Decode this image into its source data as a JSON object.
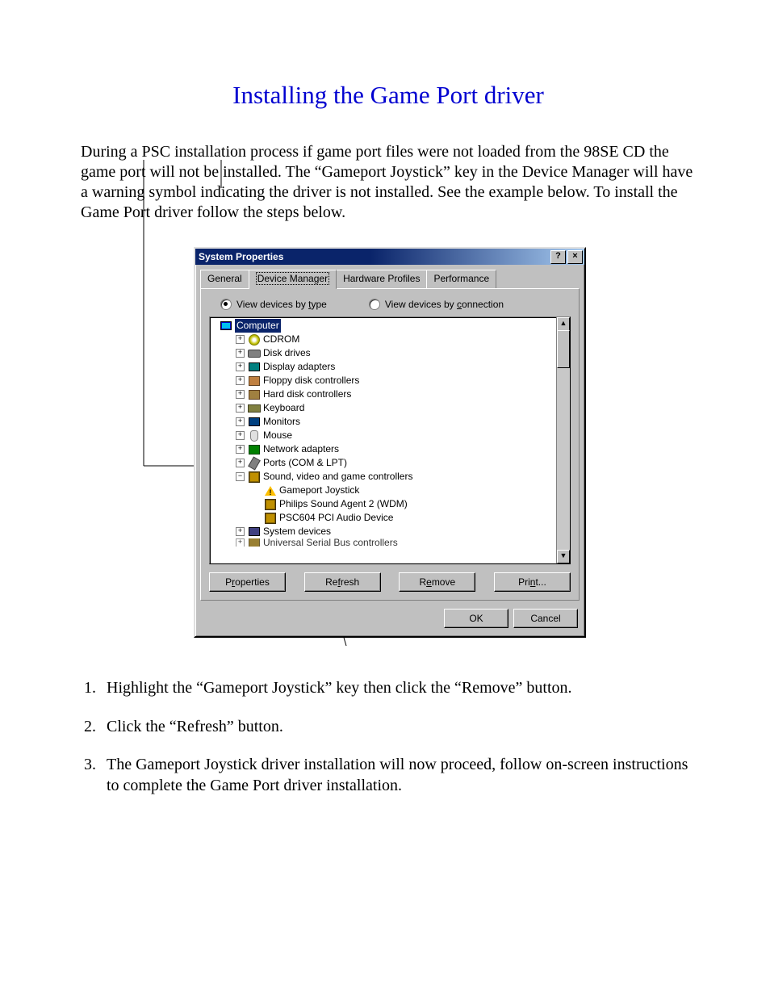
{
  "page": {
    "title": "Installing the Game Port driver",
    "intro": "During a PSC installation process if game port files were not loaded from the 98SE CD the game port will not be installed. The “Gameport Joystick” key in the Device Manager will have a warning symbol indicating the driver is not installed. See the example below. To install the Game Port driver follow the steps below.",
    "steps": [
      "Highlight the “Gameport Joystick” key then click the “Remove” button.",
      "Click the “Refresh” button.",
      "The Gameport Joystick driver installation will now proceed, follow on-screen instructions to complete the Game Port driver installation."
    ]
  },
  "dlg": {
    "title": "System Properties",
    "help_btn": "?",
    "close_btn": "×",
    "tabs": {
      "general": "General",
      "device_manager": "Device Manager",
      "hardware_profiles": "Hardware Profiles",
      "performance": "Performance"
    },
    "radios": {
      "by_type": "View devices by type",
      "by_connection": "View devices by connection"
    },
    "tree": {
      "root": "Computer",
      "items": [
        "CDROM",
        "Disk drives",
        "Display adapters",
        "Floppy disk controllers",
        "Hard disk controllers",
        "Keyboard",
        "Monitors",
        "Mouse",
        "Network adapters",
        "Ports (COM & LPT)"
      ],
      "sound_group": "Sound, video and game controllers",
      "sound_children": {
        "gameport": "Gameport Joystick",
        "wdm": "Philips Sound Agent 2 (WDM)",
        "psc604": "PSC604 PCI Audio Device"
      },
      "system_devices": "System devices",
      "usb_cut": "Universal Serial Bus controllers"
    },
    "buttons": {
      "properties": "Properties",
      "refresh": "Refresh",
      "remove": "Remove",
      "print": "Print...",
      "ok": "OK",
      "cancel": "Cancel"
    }
  }
}
